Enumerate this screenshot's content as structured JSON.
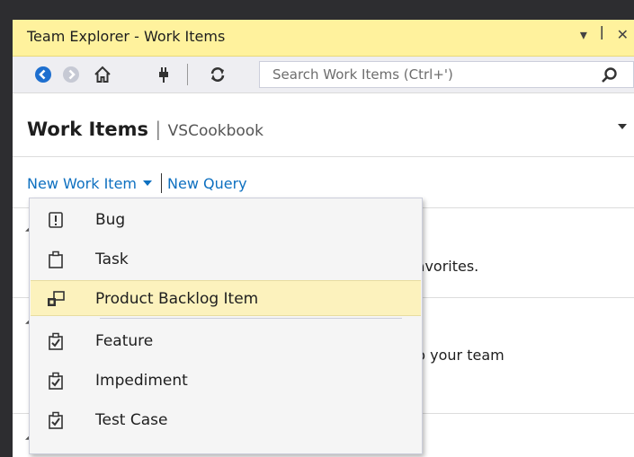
{
  "window": {
    "title": "Team Explorer - Work Items",
    "dropdown_glyph": "▾",
    "pin_glyph": "ꟾ",
    "close_glyph": "✕"
  },
  "toolbar": {
    "search_placeholder": "Search Work Items (Ctrl+')"
  },
  "page": {
    "title": "Work Items",
    "separator": "|",
    "project": "VSCookbook"
  },
  "actions": {
    "new_work_item": "New Work Item",
    "new_query": "New Query"
  },
  "background": {
    "favorites_fragment": "favorites.",
    "team_fragment": "to your team"
  },
  "menu": {
    "items": [
      {
        "label": "Bug",
        "icon": "bug-icon"
      },
      {
        "label": "Task",
        "icon": "task-icon"
      },
      {
        "label": "Product Backlog Item",
        "icon": "product-backlog-item-icon",
        "highlighted": true
      },
      {
        "label": "Feature",
        "icon": "feature-icon"
      },
      {
        "label": "Impediment",
        "icon": "impediment-icon"
      },
      {
        "label": "Test Case",
        "icon": "test-case-icon"
      }
    ]
  },
  "colors": {
    "title_bar": "#fff29d",
    "link": "#0e70c0",
    "menu_highlight": "#fcf2bd",
    "nav_icon_blue": "#1e6fcf"
  }
}
